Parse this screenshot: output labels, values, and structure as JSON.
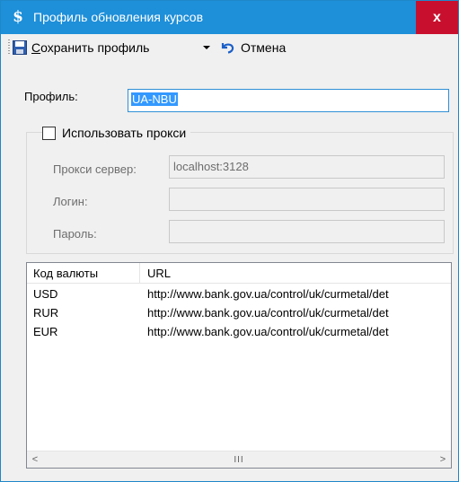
{
  "window": {
    "title": "Профиль обновления курсов",
    "icon": "dollar-sign-icon",
    "close_glyph": "x"
  },
  "toolbar": {
    "save_label_accel": "С",
    "save_label_rest": "охранить профиль",
    "cancel_label": "Отмена"
  },
  "form": {
    "profile_label": "Профиль:",
    "profile_value": "UA-NBU",
    "proxy_checkbox_label": "Использовать прокси",
    "proxy_checked": false,
    "proxy_server_label": "Прокси сервер:",
    "proxy_server_value": "localhost:3128",
    "login_label": "Логин:",
    "login_value": "",
    "password_label": "Пароль:",
    "password_value": ""
  },
  "grid": {
    "columns": [
      "Код валюты",
      "URL"
    ],
    "rows": [
      {
        "code": "USD",
        "url": "http://www.bank.gov.ua/control/uk/curmetal/det"
      },
      {
        "code": "RUR",
        "url": "http://www.bank.gov.ua/control/uk/curmetal/det"
      },
      {
        "code": "EUR",
        "url": "http://www.bank.gov.ua/control/uk/curmetal/det"
      }
    ],
    "scroll_left": "<",
    "scroll_right": ">",
    "scroll_thumb_grip": "III"
  },
  "colors": {
    "titlebar": "#1e8fd9",
    "close": "#c8102e",
    "selection": "#3399ff"
  }
}
